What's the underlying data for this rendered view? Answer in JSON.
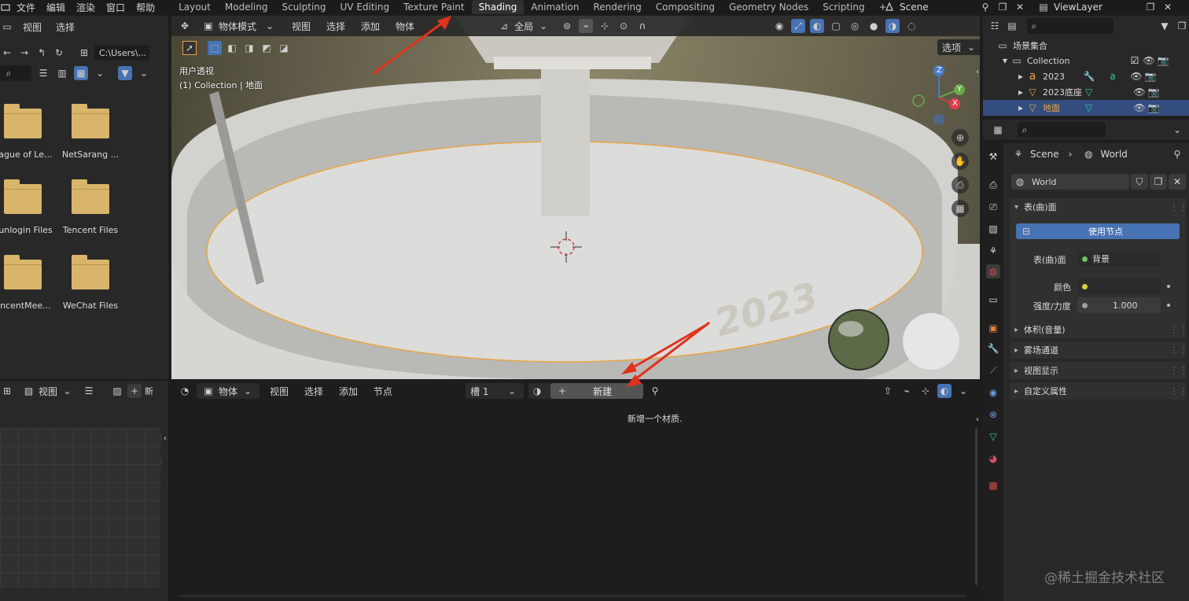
{
  "topbar": {
    "menus": [
      "文件",
      "编辑",
      "渲染",
      "窗口",
      "帮助"
    ],
    "workspaces": [
      "Layout",
      "Modeling",
      "Sculpting",
      "UV Editing",
      "Texture Paint",
      "Shading",
      "Animation",
      "Rendering",
      "Compositing",
      "Geometry Nodes",
      "Scripting"
    ],
    "active_workspace": "Shading",
    "add_tab": "+",
    "scene": "Scene",
    "view_layer": "ViewLayer"
  },
  "filebrowser": {
    "menus": [
      "视图",
      "选择"
    ],
    "path": "C:\\Users\\...",
    "items": [
      "eague of Le...",
      "NetSarang ...",
      "Sunlogin Files",
      "Tencent Files",
      "encentMee...",
      "WeChat Files"
    ]
  },
  "viewport": {
    "mode": "物体模式",
    "menus": [
      "视图",
      "选择",
      "添加",
      "物体"
    ],
    "transform_orientation": "全局",
    "options_label": "选项",
    "view_name": "用户透视",
    "collection_line": "(1) Collection | 地面",
    "axes": {
      "z": "Z",
      "y": "Y",
      "x": "X"
    },
    "text_on_model": "2023"
  },
  "imgedit": {
    "menu": "视图",
    "new_label": "新"
  },
  "shader": {
    "object_type": "物体",
    "menus": [
      "视图",
      "选择",
      "添加",
      "节点"
    ],
    "slot": "槽 1",
    "new_label": "新建",
    "hint": "新增一个材质."
  },
  "outliner": {
    "root": "场景集合",
    "collection": "Collection",
    "items": [
      "2023",
      "2023底座",
      "地面"
    ],
    "selected": "地面"
  },
  "properties": {
    "breadcrumb_scene": "Scene",
    "breadcrumb_world": "World",
    "world_name": "World",
    "surface_panel": "表(曲)面",
    "use_nodes": "使用节点",
    "surface_label": "表(曲)面",
    "surface_value": "背景",
    "color_label": "颜色",
    "strength_label": "强度/力度",
    "strength_value": "1.000",
    "panels": [
      "体积(音量)",
      "雾场通道",
      "视图显示",
      "自定义属性"
    ]
  },
  "watermark": "@稀土掘金技术社区",
  "colors": {
    "accent": "#4772b3",
    "selected_row": "#334d80",
    "active_object": "#e8a545",
    "annotation_arrow": "#e0321e"
  }
}
